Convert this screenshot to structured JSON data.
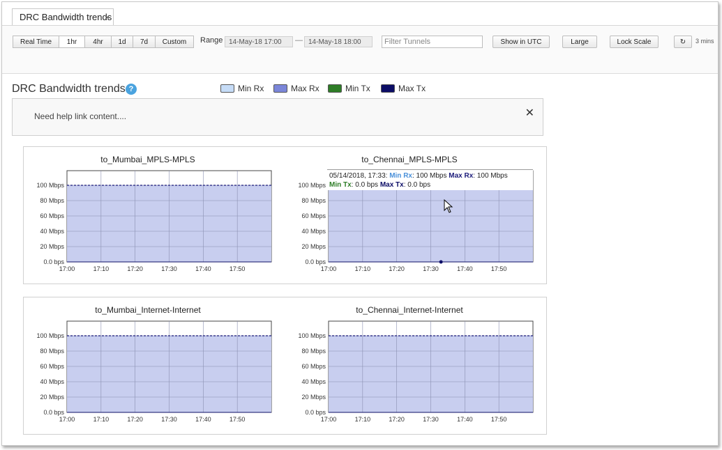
{
  "tab": {
    "label": "DRC Bandwidth trends",
    "close_glyph": "×"
  },
  "toolbar": {
    "time_buttons": [
      "Real Time",
      "1hr",
      "4hr",
      "1d",
      "7d",
      "Custom"
    ],
    "active_time_button": "1hr",
    "range_label": "Range",
    "range_start": "14-May-18 17:00",
    "range_separator": "—",
    "range_end": "14-May-18 18:00",
    "filter_placeholder": "Filter Tunnels",
    "utc_button": "Show in UTC",
    "size_button": "Large",
    "lock_button": "Lock Scale",
    "refresh_icon": "refresh-icon",
    "refresh_glyph": "↻",
    "refresh_interval": "3 mins"
  },
  "page": {
    "title": "DRC Bandwidth trends",
    "help_glyph": "?"
  },
  "legend": [
    {
      "label": "Min Rx",
      "color": "#c6dcf7"
    },
    {
      "label": "Max Rx",
      "color": "#7b86d9"
    },
    {
      "label": "Min Tx",
      "color": "#2e7d27"
    },
    {
      "label": "Max Tx",
      "color": "#0c0d66"
    }
  ],
  "help_box": {
    "text": "Need help link content....",
    "close_glyph": "✕"
  },
  "tooltip": {
    "date": "05/14/2018, 17:33:",
    "min_rx_label": "Min Rx",
    "min_rx_value": ": 100 Mbps",
    "max_rx_label": "Max Rx",
    "max_rx_value": ": 100 Mbps",
    "min_tx_label": "Min Tx",
    "min_tx_value": ": 0.0 bps",
    "max_tx_label": "Max Tx",
    "max_tx_value": ": 0.0 bps"
  },
  "chart_data": [
    {
      "type": "area",
      "title": "to_Mumbai_MPLS-MPLS",
      "x_ticks": [
        "17:00",
        "17:10",
        "17:20",
        "17:30",
        "17:40",
        "17:50"
      ],
      "y_ticks": [
        "0.0 bps",
        "20 Mbps",
        "40 Mbps",
        "60 Mbps",
        "80 Mbps",
        "100 Mbps"
      ],
      "ylim": [
        0,
        100
      ],
      "series": [
        {
          "name": "Min Rx",
          "values": [
            100,
            100
          ]
        },
        {
          "name": "Max Rx",
          "values": [
            100,
            100
          ]
        },
        {
          "name": "Min Tx",
          "values": [
            0,
            0
          ]
        },
        {
          "name": "Max Tx",
          "values": [
            0,
            0
          ]
        }
      ]
    },
    {
      "type": "area",
      "title": "to_Chennai_MPLS-MPLS",
      "x_ticks": [
        "17:00",
        "17:10",
        "17:20",
        "17:30",
        "17:40",
        "17:50"
      ],
      "y_ticks": [
        "0.0 bps",
        "20 Mbps",
        "40 Mbps",
        "60 Mbps",
        "80 Mbps",
        "100 Mbps"
      ],
      "ylim": [
        0,
        100
      ],
      "series": [
        {
          "name": "Min Rx",
          "values": [
            100,
            100
          ]
        },
        {
          "name": "Max Rx",
          "values": [
            100,
            100
          ]
        },
        {
          "name": "Min Tx",
          "values": [
            0,
            0
          ]
        },
        {
          "name": "Max Tx",
          "values": [
            0,
            0
          ]
        }
      ]
    },
    {
      "type": "area",
      "title": "to_Mumbai_Internet-Internet",
      "x_ticks": [
        "17:00",
        "17:10",
        "17:20",
        "17:30",
        "17:40",
        "17:50"
      ],
      "y_ticks": [
        "0.0 bps",
        "20 Mbps",
        "40 Mbps",
        "60 Mbps",
        "80 Mbps",
        "100 Mbps"
      ],
      "ylim": [
        0,
        100
      ],
      "series": [
        {
          "name": "Min Rx",
          "values": [
            100,
            100
          ]
        },
        {
          "name": "Max Rx",
          "values": [
            100,
            100
          ]
        },
        {
          "name": "Min Tx",
          "values": [
            0,
            0
          ]
        },
        {
          "name": "Max Tx",
          "values": [
            0,
            0
          ]
        }
      ]
    },
    {
      "type": "area",
      "title": "to_Chennai_Internet-Internet",
      "x_ticks": [
        "17:00",
        "17:10",
        "17:20",
        "17:30",
        "17:40",
        "17:50"
      ],
      "y_ticks": [
        "0.0 bps",
        "20 Mbps",
        "40 Mbps",
        "60 Mbps",
        "80 Mbps",
        "100 Mbps"
      ],
      "ylim": [
        0,
        100
      ],
      "series": [
        {
          "name": "Min Rx",
          "values": [
            100,
            100
          ]
        },
        {
          "name": "Max Rx",
          "values": [
            100,
            100
          ]
        },
        {
          "name": "Min Tx",
          "values": [
            0,
            0
          ]
        },
        {
          "name": "Max Tx",
          "values": [
            0,
            0
          ]
        }
      ]
    }
  ]
}
